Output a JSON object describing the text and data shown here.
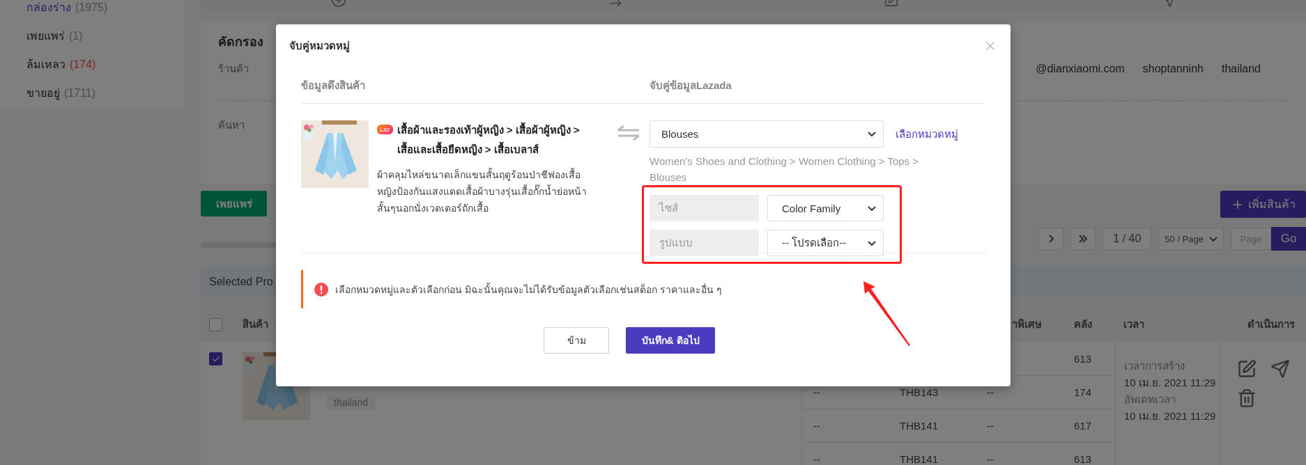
{
  "sidebar": {
    "items": [
      {
        "label": "กล่องร่าง",
        "count": "(1975)",
        "selected": true,
        "kind": "normal"
      },
      {
        "label": "เพยแพร่",
        "count": "(1)",
        "selected": false,
        "kind": "normal"
      },
      {
        "label": "ล้มเหลว",
        "count": "(174)",
        "selected": false,
        "kind": "error"
      },
      {
        "label": "ขายอยู่",
        "count": "(1711)",
        "selected": false,
        "kind": "normal"
      }
    ]
  },
  "filter": {
    "title": "คัดกรอง",
    "shop_label": "ร้านค้า",
    "shops": [
      "@dianxiaomi.com",
      "shoptanninh",
      "thailand"
    ],
    "search_label": "ค้นหา"
  },
  "toolbar": {
    "publish_button": "เพยแพร่",
    "add_button": "เพิ่มสินค้า"
  },
  "pagination": {
    "page": "1 / 40",
    "page_size": "50 / Page",
    "page_placeholder": "Page",
    "go_button": "Go"
  },
  "selected_bar": {
    "text": "Selected Pro"
  },
  "table": {
    "all_checked": false,
    "columns": [
      {
        "label": "สินค้า"
      },
      {
        "label": "าพิเศษ"
      },
      {
        "label": "คลัง"
      },
      {
        "label": "เวลา"
      },
      {
        "label": "ดำเนินการ"
      }
    ],
    "product": {
      "checked": true,
      "tag": "thailand"
    },
    "variants": [
      {
        "stock": "613"
      },
      {
        "column_1": "--",
        "column_2": "THB143",
        "column_3": "--",
        "stock": "174"
      },
      {
        "column_1": "--",
        "column_2": "THB141",
        "column_3": "--",
        "stock": "617"
      },
      {
        "column_1": "--",
        "column_2": "THB141",
        "column_3": "--",
        "stock": "613"
      }
    ],
    "times": [
      "เวลาการสร้าง",
      "10 เม.ย. 2021 11:29",
      "อัพเดทเวลา",
      "10 เม.ย. 2021 11:29"
    ]
  },
  "dialog": {
    "title": "จับคู่หมวดหมู่",
    "source_heading": "ข้อมูลดึงสินค้า",
    "target_heading": "จับคู่ข้อมูลLazada",
    "product": {
      "badge": "Laz",
      "category": "เสื้อผ้าและรองเท้าผู้หญิง > เสื้อผ้าผู้หญิง > เสื้อและเสื้อยืดหญิง > เสื้อเบลาส์",
      "title": "ผ้าคลุมไหล่ขนาดเล็กแขนสั้นฤดูร้อนป่าชีฟองเสื้อหญิงป้องกันแสงแดดเสื้อผ้าบางรุ่นเสื้อกั๊กน้ำย่อหน้าสั้นๆนอกนั่งเวตเตอร์ถักเสื้อ"
    },
    "category_select": "Blouses",
    "choose_link": "เลือกหมวดหมู่",
    "category_path": "Women's Shoes and Clothing > Women Clothing > Tops > Blouses",
    "variations": [
      {
        "name": "ไซส์",
        "value": "Color Family"
      },
      {
        "name": "รูปแบบ",
        "value": "-- โปรดเลือก--"
      }
    ],
    "notice": "เลือกหมวดหมู่และตัวเลือกก่อน มิฉะนั้นคุณจะไม่ได้รับข้อมูลตัวเลือกเช่นสต็อก ราคาและอื่น ๆ",
    "skip_button": "ข้าม",
    "save_button": "บันทึก& ติอไป"
  }
}
